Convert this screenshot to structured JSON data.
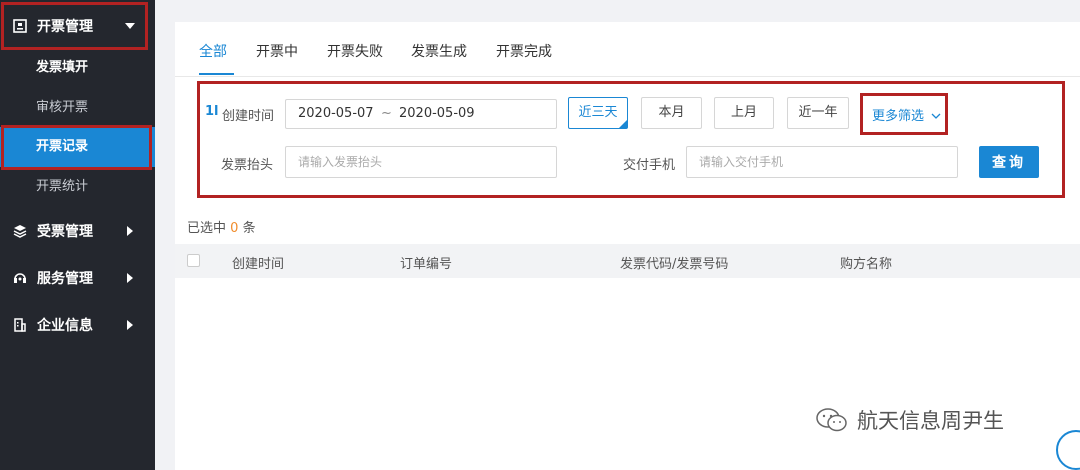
{
  "sidebar": {
    "groups": [
      {
        "label": "开票管理",
        "icon": "invoice-icon"
      },
      {
        "label": "受票管理",
        "icon": "layers-icon"
      },
      {
        "label": "服务管理",
        "icon": "headset-icon"
      },
      {
        "label": "企业信息",
        "icon": "building-icon"
      }
    ],
    "items": [
      {
        "label": "发票填开"
      },
      {
        "label": "审核开票"
      },
      {
        "label": "开票记录"
      },
      {
        "label": "开票统计"
      }
    ]
  },
  "tabs": [
    {
      "label": "全部"
    },
    {
      "label": "开票中"
    },
    {
      "label": "开票失败"
    },
    {
      "label": "发票生成"
    },
    {
      "label": "开票完成"
    }
  ],
  "filter": {
    "sort_icon": "1l",
    "created_label": "创建时间",
    "date_start": "2020-05-07",
    "date_sep": "~",
    "date_end": "2020-05-09",
    "periods": [
      "近三天",
      "本月",
      "上月",
      "近一年"
    ],
    "more_filter": "更多筛选",
    "invoice_title_label": "发票抬头",
    "invoice_title_placeholder": "请输入发票抬头",
    "phone_label": "交付手机",
    "phone_placeholder": "请输入交付手机",
    "query_button": "查询"
  },
  "selection": {
    "prefix": "已选中",
    "count": "0",
    "suffix": "条"
  },
  "table": {
    "columns": [
      "创建时间",
      "订单编号",
      "发票代码/发票号码",
      "购方名称"
    ]
  },
  "watermark": {
    "text": "航天信息周尹生"
  },
  "colors": {
    "accent": "#1a87d4",
    "sidebar_bg": "#24272e",
    "highlight_box": "#b22222",
    "count": "#f08c2c"
  }
}
